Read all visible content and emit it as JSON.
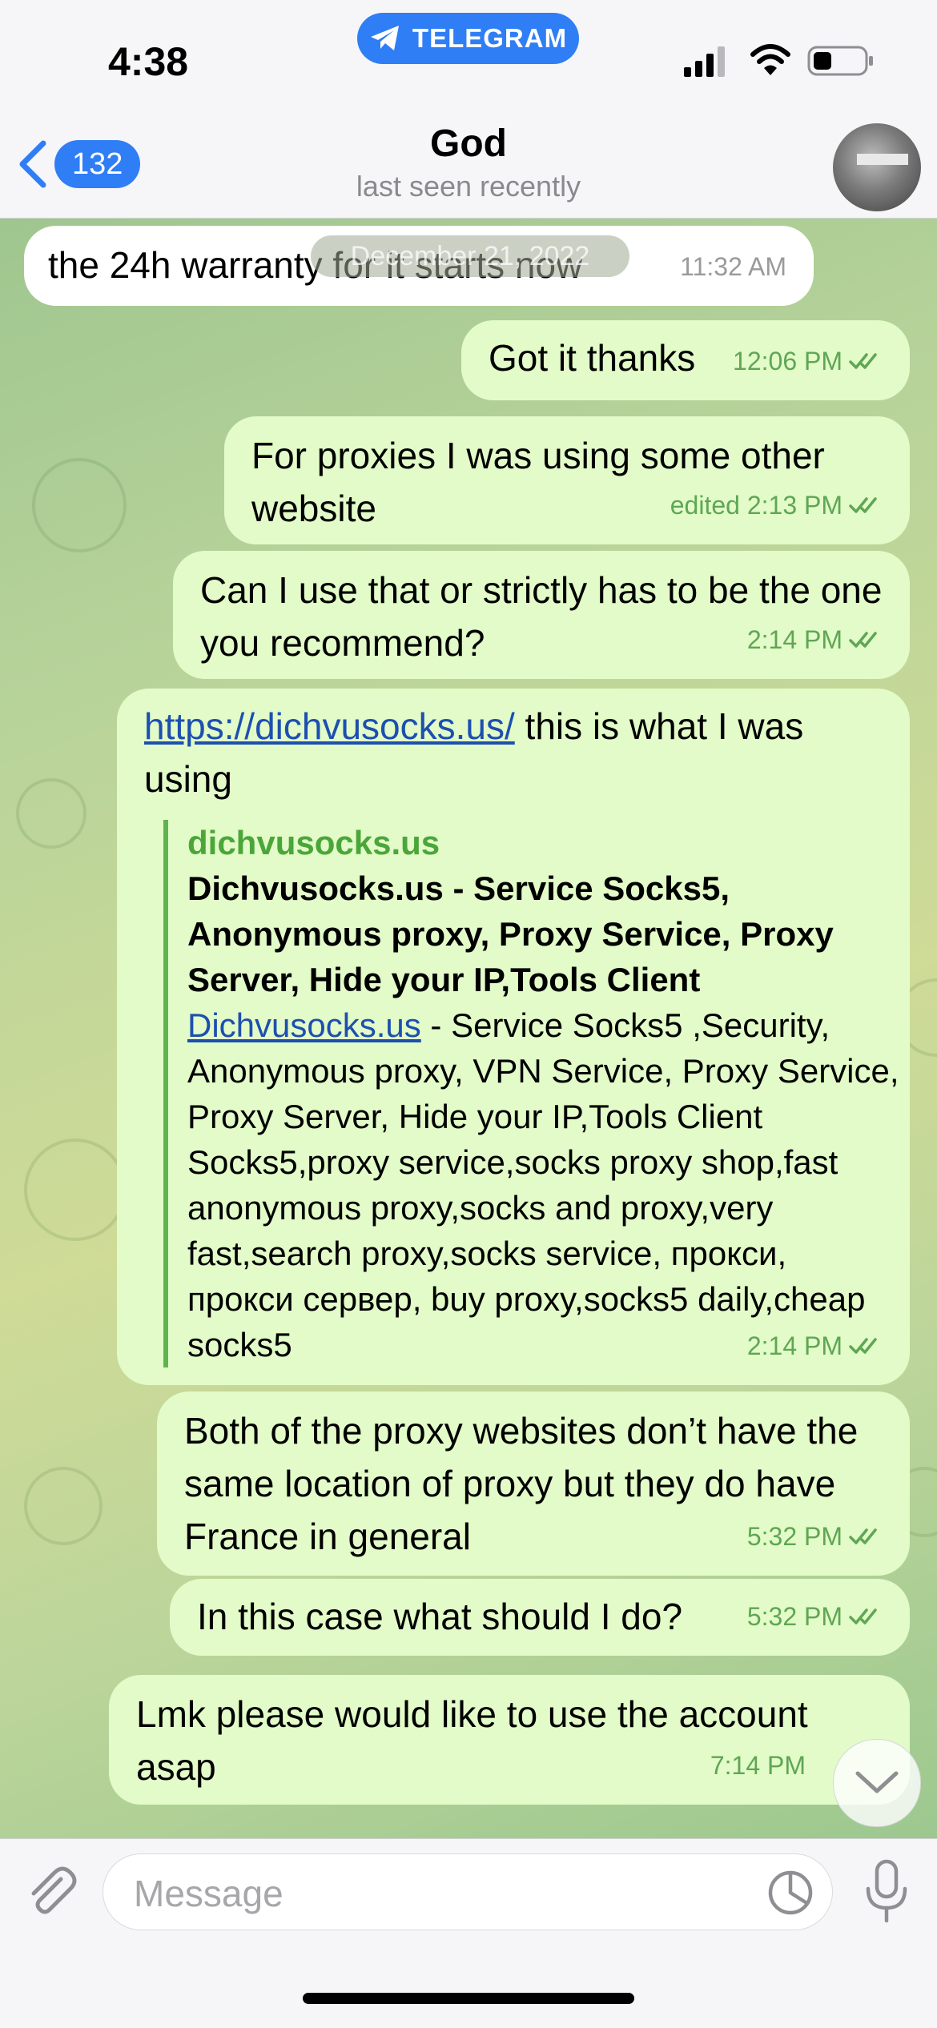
{
  "status_bar": {
    "time": "4:38",
    "app_pill": "TELEGRAM"
  },
  "header": {
    "back_count": "132",
    "contact_name": "God",
    "status": "last seen recently"
  },
  "date_divider": "December 21, 2022",
  "messages": [
    {
      "dir": "in",
      "text": "the 24h warranty for it starts now",
      "time": "11:32 AM"
    },
    {
      "dir": "out",
      "text": "Got it thanks",
      "time": "12:06 PM"
    },
    {
      "dir": "out",
      "text": "For proxies I was using some other website",
      "time": "edited 2:13 PM"
    },
    {
      "dir": "out",
      "text": "Can I use that or strictly has to be the one you recommend?",
      "time": "2:14 PM"
    },
    {
      "dir": "out",
      "link_text": "https://dichvusocks.us/",
      "text": " this is what I was using",
      "time": "2:14 PM",
      "preview": {
        "site": "dichvusocks.us",
        "title": "Dichvusocks.us - Service Socks5, Anonymous proxy, Proxy Service, Proxy Server, Hide your IP,Tools Client",
        "desc_link": "Dichvusocks.us",
        "desc": " - Service Socks5 ,Security, Anonymous proxy, VPN Service, Proxy Service, Proxy Server, Hide your IP,Tools Client Socks5,proxy service,socks proxy shop,fast anonymous proxy,socks and proxy,very fast,search proxy,socks service, прокси, прокси сервер, buy proxy,socks5 daily,cheap socks5"
      }
    },
    {
      "dir": "out",
      "text": "Both of the proxy websites don’t have the same location of proxy but they do have France in general",
      "time": "5:32 PM"
    },
    {
      "dir": "out",
      "text": "In this case what should I do?",
      "time": "5:32 PM"
    },
    {
      "dir": "out",
      "text": "Lmk please would like to use the account asap",
      "time": "7:14 PM"
    }
  ],
  "input": {
    "placeholder": "Message"
  },
  "colors": {
    "accent": "#2f7ef6",
    "outgoing_bubble": "#e2fbc8",
    "time_green": "#5fa655"
  }
}
